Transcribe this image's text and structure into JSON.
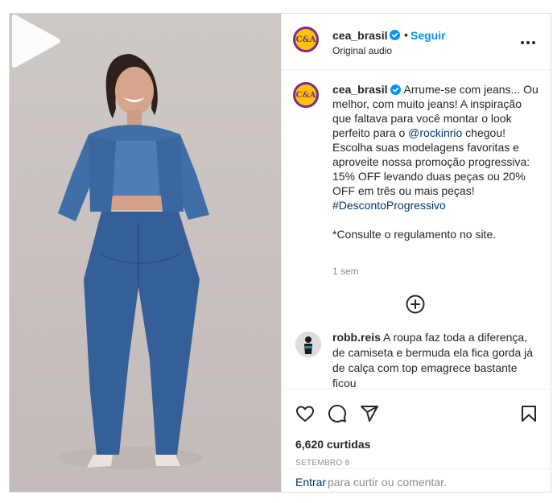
{
  "post": {
    "account": {
      "username": "cea_brasil",
      "avatar_text": "C&A",
      "verified": true,
      "follow_label": "Seguir",
      "separator": "•",
      "audio_label": "Original audio"
    },
    "caption": {
      "username": "cea_brasil",
      "text_1": " Arrume-se com jeans... Ou melhor, com muito jeans! A inspiração que faltava para você montar o look perfeito para o ",
      "mention": "@rockinrio",
      "text_2": " chegou! Escolha suas modelagens favoritas e aproveite nossa promoção progressiva: 15% OFF levando duas peças ou 20% OFF em três ou mais peças!",
      "hashtag": "#DescontoProgressivo",
      "note": "*Consulte o regulamento no site.",
      "time": "1 sem"
    },
    "comment": {
      "username": "robb.reis",
      "text": " A roupa faz toda a diferença, de camiseta e bermuda ela fica gorda já de calça com top emagrece bastante ficou"
    },
    "likes": "6,620 curtidas",
    "date": "SETEMBRO 8",
    "add_comment": {
      "login_label": "Entrar",
      "rest_text": "para curtir ou comentar."
    }
  },
  "icons": {
    "more": "more-options-icon",
    "verified": "verified-badge-icon",
    "load_more": "plus-circle-icon",
    "like": "heart-icon",
    "comment": "comment-bubble-icon",
    "share": "paper-plane-icon",
    "save": "bookmark-icon",
    "play": "play-icon"
  },
  "colors": {
    "accent": "#0095f6",
    "link": "#00376b",
    "brand_yellow": "#ffc400",
    "brand_purple": "#7b2c8f",
    "muted": "#8e8e8e"
  }
}
